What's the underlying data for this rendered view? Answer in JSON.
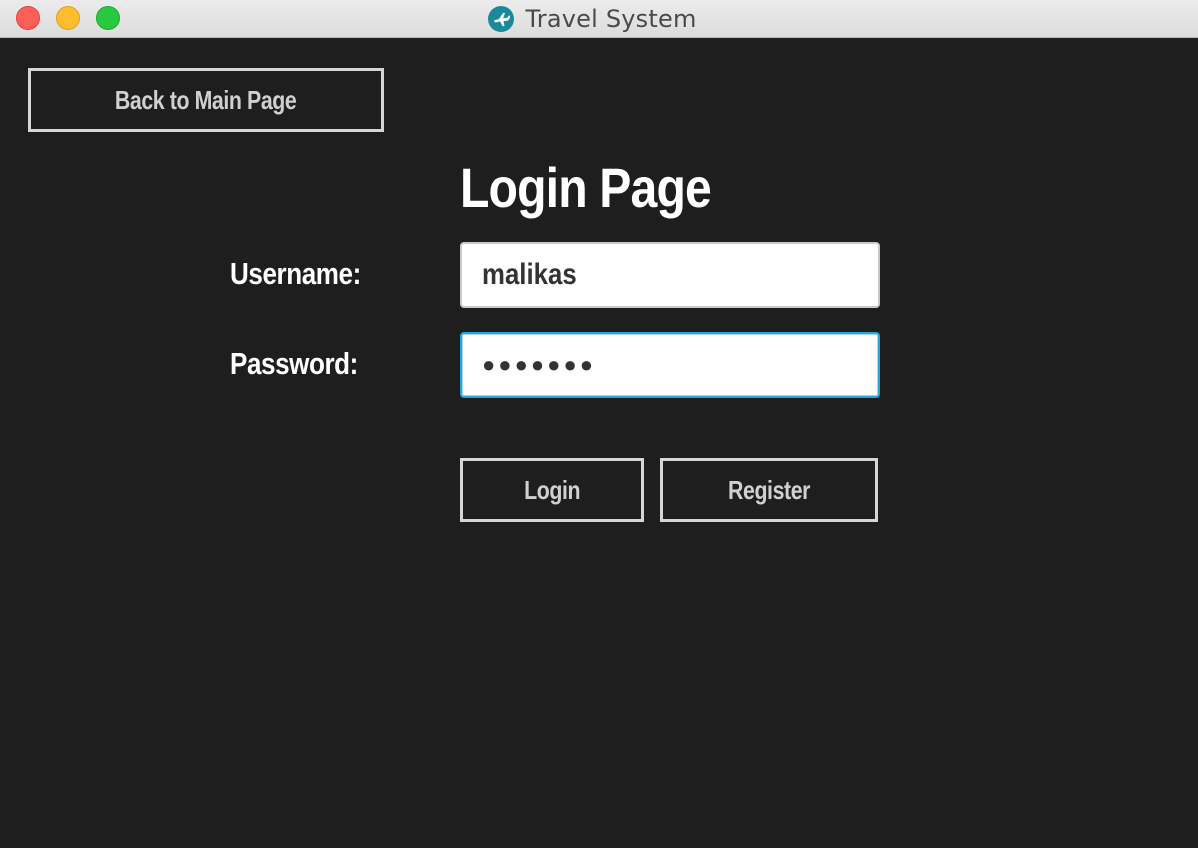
{
  "window": {
    "title": "Travel System",
    "app_icon": "airplane-icon",
    "accent_color": "#1a8a9a"
  },
  "nav": {
    "back_label": "Back to Main Page"
  },
  "page": {
    "title": "Login Page"
  },
  "form": {
    "username_label": "Username:",
    "username_value": "malikas",
    "password_label": "Password:",
    "password_mask": "●●●●●●●",
    "password_length": 7,
    "focused_field": "password"
  },
  "actions": {
    "login_label": "Login",
    "register_label": "Register"
  },
  "colors": {
    "background": "#1e1e1e",
    "button_border": "#d6d6d6",
    "focus_ring": "#2ba4d9"
  }
}
